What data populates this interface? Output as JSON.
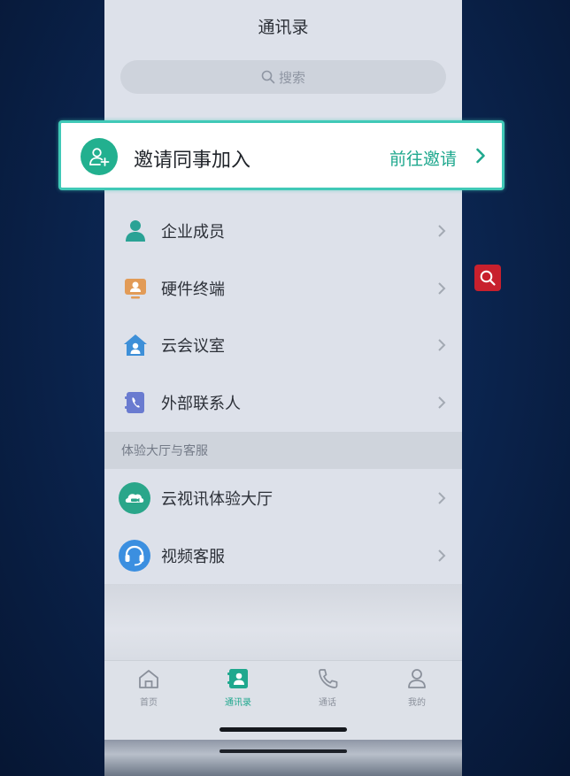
{
  "header": {
    "title": "通讯录"
  },
  "search": {
    "placeholder": "搜索"
  },
  "invite": {
    "title": "邀请同事加入",
    "action": "前往邀请"
  },
  "contacts": {
    "items": [
      {
        "label": "企业成员",
        "icon": "person-icon"
      },
      {
        "label": "硬件终端",
        "icon": "device-icon"
      },
      {
        "label": "云会议室",
        "icon": "room-icon"
      },
      {
        "label": "外部联系人",
        "icon": "phonebook-icon"
      }
    ]
  },
  "service": {
    "section_title": "体验大厅与客服",
    "items": [
      {
        "label": "云视讯体验大厅",
        "icon": "cloud-video-icon"
      },
      {
        "label": "视频客服",
        "icon": "headset-icon"
      }
    ]
  },
  "tabs": [
    {
      "label": "首页",
      "icon": "home-icon",
      "active": false
    },
    {
      "label": "通讯录",
      "icon": "contacts-icon",
      "active": true
    },
    {
      "label": "通话",
      "icon": "phone-icon",
      "active": false
    },
    {
      "label": "我的",
      "icon": "user-icon",
      "active": false
    }
  ],
  "colors": {
    "accent": "#1fa88e",
    "highlight_border": "#40c9b7",
    "float_button": "#c8202d"
  }
}
